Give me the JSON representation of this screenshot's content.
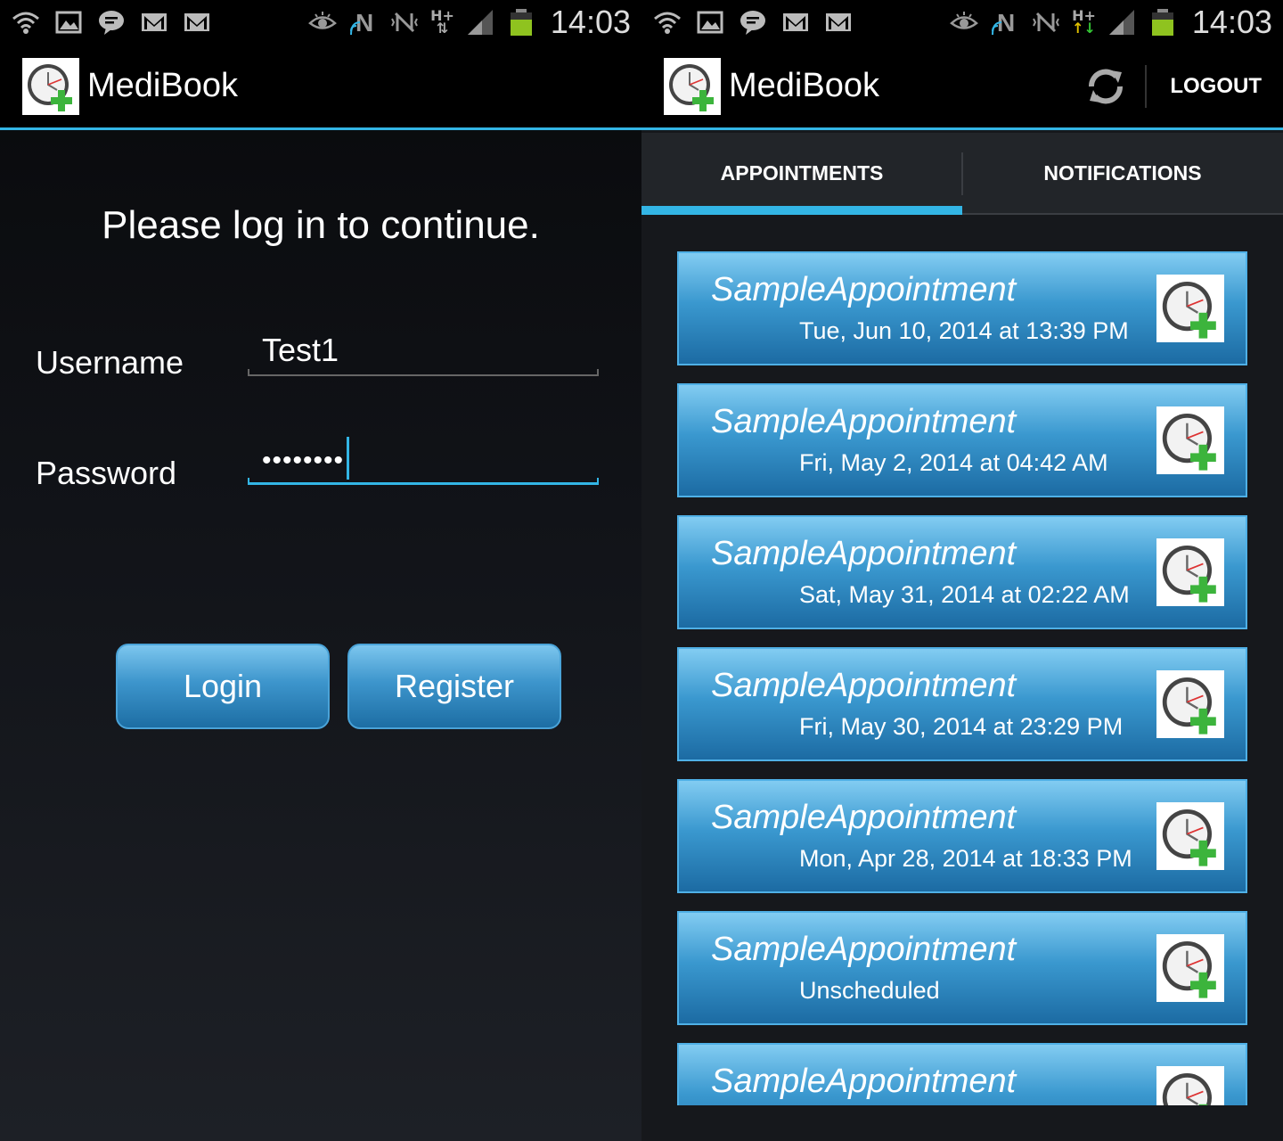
{
  "status_bar": {
    "time": "14:03",
    "network": "H+"
  },
  "app": {
    "title": "MediBook"
  },
  "login": {
    "heading": "Please log in to continue.",
    "username_label": "Username",
    "username_value": "Test1",
    "password_label": "Password",
    "password_value": "••••••••",
    "login_button": "Login",
    "register_button": "Register"
  },
  "main": {
    "logout_label": "LOGOUT",
    "tabs": [
      {
        "label": "APPOINTMENTS",
        "active": true
      },
      {
        "label": "NOTIFICATIONS",
        "active": false
      }
    ],
    "appointments": [
      {
        "title": "SampleAppointment",
        "date": "Tue, Jun 10, 2014 at 13:39 PM"
      },
      {
        "title": "SampleAppointment",
        "date": "Fri, May 2, 2014 at 04:42 AM"
      },
      {
        "title": "SampleAppointment",
        "date": "Sat, May 31, 2014 at 02:22 AM"
      },
      {
        "title": "SampleAppointment",
        "date": "Fri, May 30, 2014 at 23:29 PM"
      },
      {
        "title": "SampleAppointment",
        "date": "Mon, Apr 28, 2014 at 18:33 PM"
      },
      {
        "title": "SampleAppointment",
        "date": "Unscheduled"
      },
      {
        "title": "SampleAppointment",
        "date": ""
      }
    ]
  },
  "colors": {
    "accent": "#33b5e5",
    "button_top": "#7cc6ee",
    "button_bottom": "#1d6ea4",
    "battery": "#8fc31f"
  },
  "icons": [
    "wifi-icon",
    "image-icon",
    "chat-icon",
    "mail-icon",
    "eye-icon",
    "nfc-icon",
    "vibrate-icon",
    "signal-icon",
    "battery-icon",
    "clock-plus-icon",
    "refresh-icon"
  ]
}
